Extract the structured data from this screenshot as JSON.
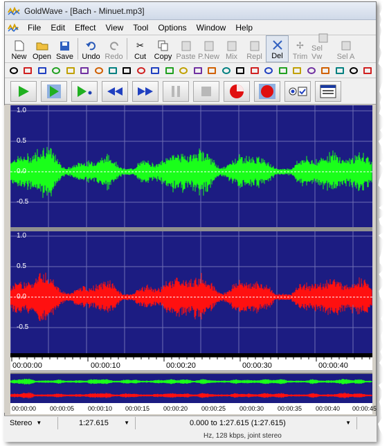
{
  "window": {
    "app_name": "GoldWave",
    "title": "GoldWave - [Bach - Minuet.mp3]"
  },
  "menu": [
    {
      "label": "File"
    },
    {
      "label": "Edit"
    },
    {
      "label": "Effect"
    },
    {
      "label": "View"
    },
    {
      "label": "Tool"
    },
    {
      "label": "Options"
    },
    {
      "label": "Window"
    },
    {
      "label": "Help"
    }
  ],
  "toolbar": {
    "buttons": [
      {
        "label": "New",
        "icon": "new-file-icon",
        "enabled": true
      },
      {
        "label": "Open",
        "icon": "open-folder-icon",
        "enabled": true
      },
      {
        "label": "Save",
        "icon": "save-disk-icon",
        "enabled": true
      },
      {
        "label": "Undo",
        "icon": "undo-icon",
        "enabled": true
      },
      {
        "label": "Redo",
        "icon": "redo-icon",
        "enabled": false
      },
      {
        "label": "Cut",
        "icon": "scissors-icon",
        "enabled": true
      },
      {
        "label": "Copy",
        "icon": "copy-icon",
        "enabled": true
      },
      {
        "label": "Paste",
        "icon": "paste-icon",
        "enabled": false
      },
      {
        "label": "P.New",
        "icon": "paste-new-icon",
        "enabled": false
      },
      {
        "label": "Mix",
        "icon": "mix-icon",
        "enabled": false
      },
      {
        "label": "Repl",
        "icon": "replace-icon",
        "enabled": false
      },
      {
        "label": "Del",
        "icon": "delete-icon",
        "enabled": true
      },
      {
        "label": "Trim",
        "icon": "trim-icon",
        "enabled": false
      },
      {
        "label": "Sel Vw",
        "icon": "select-view-icon",
        "enabled": false
      },
      {
        "label": "Sel A",
        "icon": "select-all-icon",
        "enabled": false
      }
    ]
  },
  "effects_toolbar": {
    "icons": [
      "fx-1-icon",
      "fx-2-icon",
      "fx-3-icon",
      "fx-4-icon",
      "fx-5-icon",
      "fx-6-icon",
      "fx-7-icon",
      "fx-8-icon",
      "fx-9-icon",
      "fx-10-icon",
      "fx-11-icon",
      "fx-12-icon",
      "fx-13-icon",
      "fx-14-icon",
      "fx-15-icon",
      "fx-16-icon",
      "fx-17-icon",
      "fx-18-icon",
      "fx-19-icon",
      "fx-20-icon",
      "fx-21-icon",
      "fx-22-icon",
      "fx-23-icon",
      "fx-24-icon",
      "fx-25-icon",
      "fx-26-icon"
    ]
  },
  "transport": {
    "buttons": [
      {
        "name": "play-button",
        "icon": "play-icon"
      },
      {
        "name": "play-selection-button",
        "icon": "play-selection-icon"
      },
      {
        "name": "play-from-cursor-button",
        "icon": "play-cursor-icon"
      },
      {
        "name": "rewind-button",
        "icon": "rewind-icon"
      },
      {
        "name": "fast-forward-button",
        "icon": "fast-forward-icon"
      },
      {
        "name": "pause-button",
        "icon": "pause-icon"
      },
      {
        "name": "stop-button",
        "icon": "stop-icon"
      },
      {
        "name": "record-button",
        "icon": "record-icon"
      },
      {
        "name": "record-selection-button",
        "icon": "record-selection-icon"
      },
      {
        "name": "device-options-button",
        "icon": "checkbox-icon"
      },
      {
        "name": "control-window-button",
        "icon": "control-window-icon"
      }
    ]
  },
  "waveform": {
    "top_channel_labels": [
      "1.0",
      "0.5",
      "0.0",
      "-0.5"
    ],
    "bottom_channel_labels": [
      "1.0",
      "0.5",
      "0.0",
      "-0.5"
    ],
    "colors": {
      "background": "#1c1c82",
      "left_channel": "#1aff1a",
      "right_channel": "#ff1010",
      "grid": "#6e6eb4"
    }
  },
  "timeline": {
    "labels": [
      "00:00:00",
      "00:00:10",
      "00:00:20",
      "00:00:30",
      "00:00:40"
    ]
  },
  "overview_timeline": {
    "labels": [
      "00:00:00",
      "00:00:05",
      "00:00:10",
      "00:00:15",
      "00:00:20",
      "00:00:25",
      "00:00:30",
      "00:00:35",
      "00:00:40",
      "00:00:45"
    ]
  },
  "status": {
    "channel_mode": "Stereo",
    "length": "1:27.615",
    "selection": "0.000 to 1:27.615 (1:27.615)",
    "format_info": "Hz, 128 kbps, joint stereo"
  }
}
